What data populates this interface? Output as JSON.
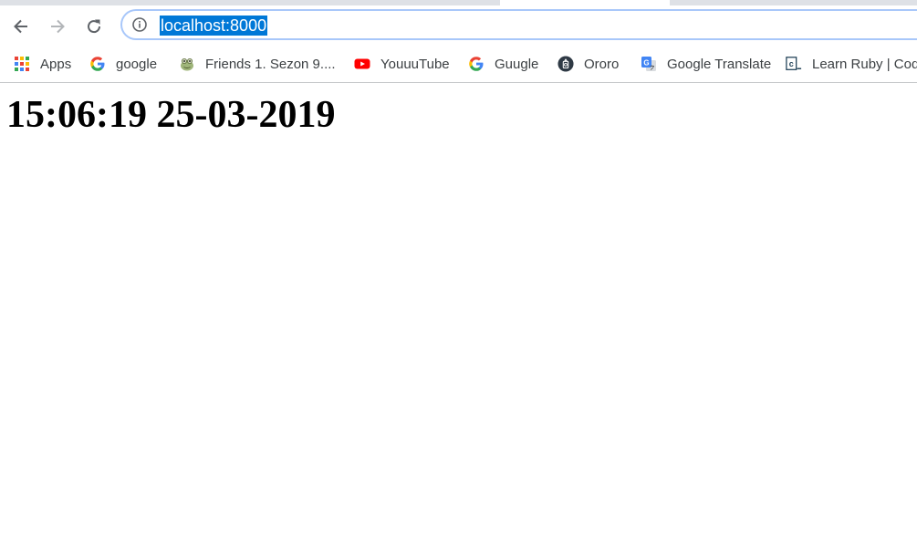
{
  "browser": {
    "address_bar": {
      "url": "localhost:8000",
      "url_selected": true,
      "selection_color": "#0078d7"
    },
    "nav": {
      "back_icon": "arrow-left-icon",
      "forward_icon": "arrow-right-icon",
      "reload_icon": "reload-icon",
      "info_icon": "info-circle-icon"
    },
    "bookmarks": [
      {
        "label": "Apps",
        "icon": "apps-grid-icon"
      },
      {
        "label": "google",
        "icon": "google-g-icon"
      },
      {
        "label": "Friends 1. Sezon 9....",
        "icon": "frog-favicon-icon"
      },
      {
        "label": "YouuuTube",
        "icon": "youtube-icon"
      },
      {
        "label": "Guugle",
        "icon": "google-g-icon"
      },
      {
        "label": "Ororo",
        "icon": "ororo-icon"
      },
      {
        "label": "Google Translate",
        "icon": "google-translate-icon"
      },
      {
        "label": "Learn Ruby | Cod",
        "icon": "codecademy-icon"
      }
    ]
  },
  "page": {
    "clock_text": "15:06:19 25-03-2019"
  }
}
